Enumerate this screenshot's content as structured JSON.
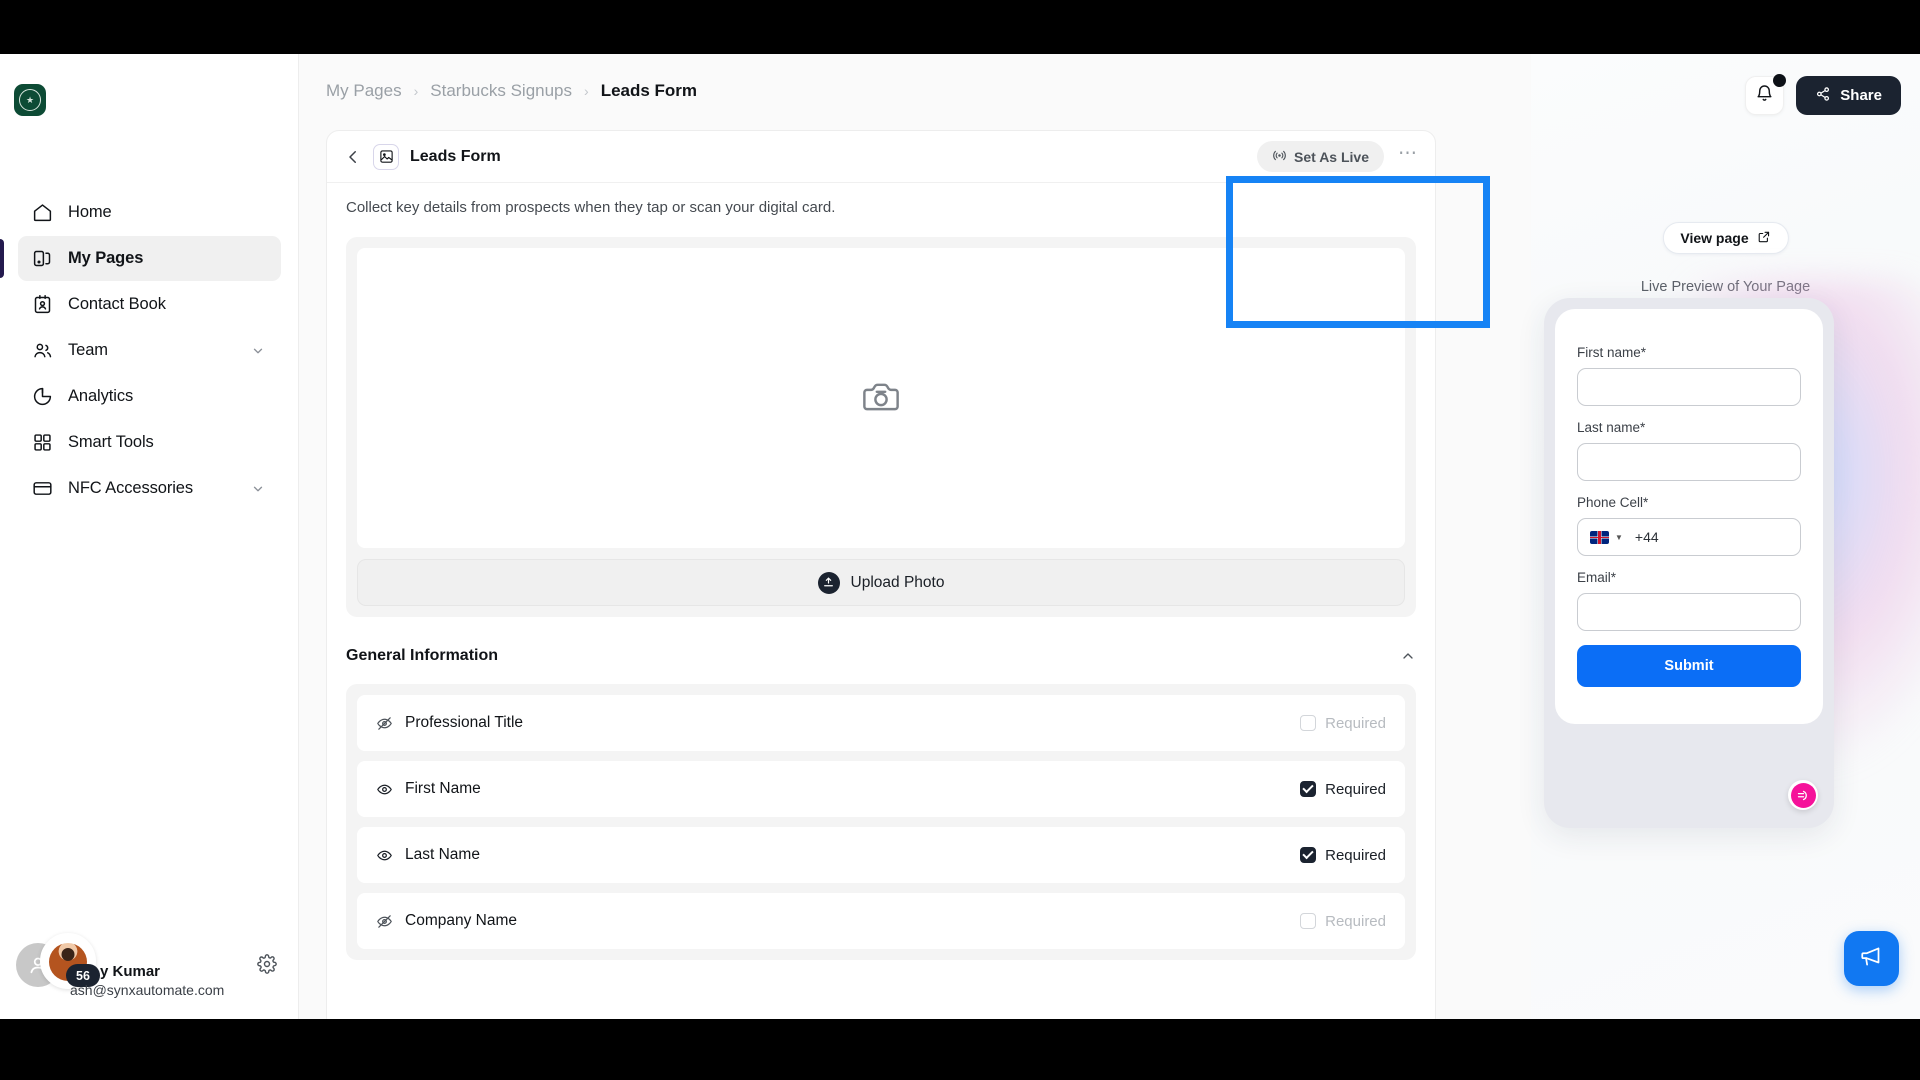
{
  "sidebar": {
    "logo_name": "starbucks-logo",
    "items": [
      {
        "label": "Home",
        "icon": "home-icon",
        "active": false,
        "chevron": false
      },
      {
        "label": "My Pages",
        "icon": "pages-icon",
        "active": true,
        "chevron": false
      },
      {
        "label": "Contact Book",
        "icon": "contact-book-icon",
        "active": false,
        "chevron": false
      },
      {
        "label": "Team",
        "icon": "team-icon",
        "active": false,
        "chevron": true
      },
      {
        "label": "Analytics",
        "icon": "analytics-icon",
        "active": false,
        "chevron": false
      },
      {
        "label": "Smart Tools",
        "icon": "smart-tools-icon",
        "active": false,
        "chevron": false
      },
      {
        "label": "NFC Accessories",
        "icon": "nfc-card-icon",
        "active": false,
        "chevron": true
      }
    ],
    "profile": {
      "badge_count": "56",
      "name": "y Kumar",
      "email": "ash@synxautomate.com",
      "settings_icon": "gear-icon"
    }
  },
  "topbar": {
    "notifications_icon": "bell-icon",
    "share_label": "Share",
    "share_icon": "share-icon"
  },
  "breadcrumb": {
    "items": [
      "My Pages",
      "Starbucks Signups",
      "Leads Form"
    ],
    "separator": "›"
  },
  "card": {
    "back_icon": "chevron-left-icon",
    "type_icon": "image-icon",
    "title": "Leads Form",
    "set_as_live_label": "Set As Live",
    "set_as_live_icon": "broadcast-icon",
    "more_label": "⋯",
    "subtitle": "Collect key details from prospects when they tap or scan your digital card.",
    "photo_placeholder_icon": "camera-icon",
    "upload_label": "Upload Photo",
    "upload_icon": "upload-icon"
  },
  "general_information": {
    "heading": "General Information",
    "collapse_icon": "chevron-up-icon",
    "required_label": "Required",
    "fields": [
      {
        "label": "Professional Title",
        "visible": false,
        "required": false
      },
      {
        "label": "First Name",
        "visible": true,
        "required": true
      },
      {
        "label": "Last Name",
        "visible": true,
        "required": true
      },
      {
        "label": "Company Name",
        "visible": false,
        "required": false
      }
    ]
  },
  "preview": {
    "view_page_label": "View page",
    "view_page_icon": "external-link-icon",
    "caption": "Live Preview of Your Page",
    "form": {
      "fields": [
        {
          "label": "First name*",
          "value": "",
          "type": "text"
        },
        {
          "label": "Last name*",
          "value": "",
          "type": "text"
        },
        {
          "label": "Phone Cell*",
          "value": "+44",
          "type": "phone",
          "flag": "uk-flag-icon"
        },
        {
          "label": "Email*",
          "value": "",
          "type": "text"
        }
      ],
      "submit_label": "Submit"
    },
    "fab_icon": "send-arrow-icon"
  },
  "chat_widget": {
    "icon": "megaphone-icon"
  },
  "colors": {
    "accent_blue": "#0b6ef6",
    "highlight_blue": "#1683f5",
    "dark": "#1b2330",
    "sidebar_indicator": "#241a4e",
    "pink": "#f5129a",
    "brand_green": "#0d4b35"
  }
}
